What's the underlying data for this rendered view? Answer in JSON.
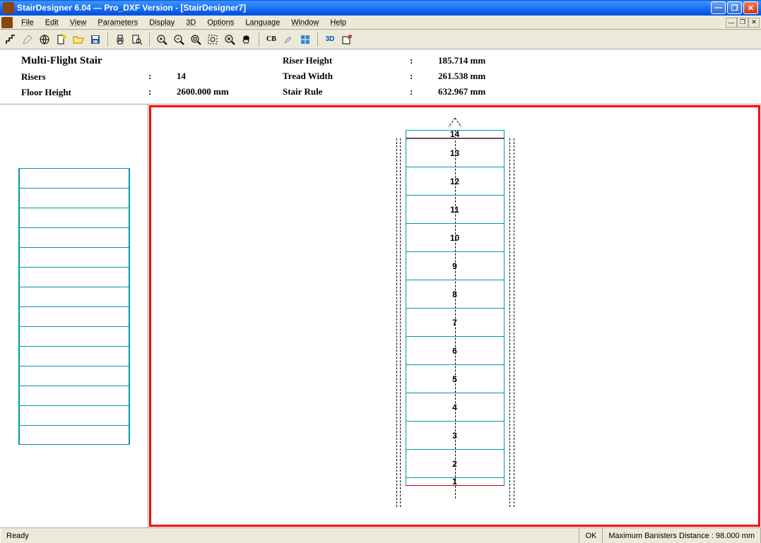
{
  "window": {
    "title": "StairDesigner 6.04 — Pro_DXF Version - [StairDesigner7]"
  },
  "menu": {
    "file": "File",
    "edit": "Edit",
    "view": "View",
    "parameters": "Parameters",
    "display": "Display",
    "threeD": "3D",
    "options": "Options",
    "language": "Language",
    "window": "Window",
    "help": "Help"
  },
  "toolbar": {
    "cb": "CB",
    "threeD": "3D"
  },
  "info": {
    "title": "Multi-Flight Stair",
    "risers_label": "Risers",
    "risers_value": "14",
    "floor_height_label": "Floor Height",
    "floor_height_value": "2600.000 mm",
    "riser_height_label": "Riser Height",
    "riser_height_value": "185.714 mm",
    "tread_width_label": "Tread Width",
    "tread_width_value": "261.538 mm",
    "stair_rule_label": "Stair Rule",
    "stair_rule_value": "632.967 mm"
  },
  "treads": {
    "t14": "14",
    "t13": "13",
    "t12": "12",
    "t11": "11",
    "t10": "10",
    "t9": "9",
    "t8": "8",
    "t7": "7",
    "t6": "6",
    "t5": "5",
    "t4": "4",
    "t3": "3",
    "t2": "2",
    "t1": "1"
  },
  "status": {
    "ready": "Ready",
    "ok": "OK",
    "banisters": "Maximum Banisters Distance : 98.000 mm"
  }
}
